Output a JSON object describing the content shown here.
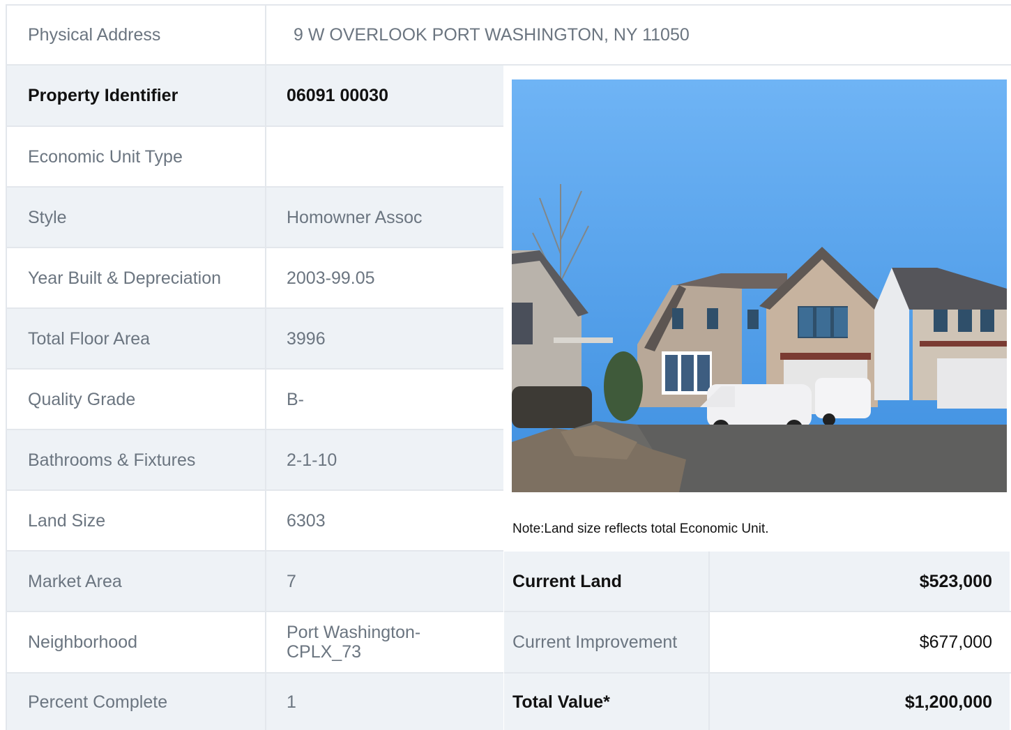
{
  "address": {
    "label": "Physical Address",
    "value": "9 W OVERLOOK   PORT WASHINGTON, NY  11050"
  },
  "details": [
    {
      "label": "Property Identifier",
      "value": "06091  00030"
    },
    {
      "label": "Economic Unit Type",
      "value": ""
    },
    {
      "label": "Style",
      "value": "Homowner Assoc"
    },
    {
      "label": "Year Built & Depreciation",
      "value": "2003-99.05"
    },
    {
      "label": "Total Floor Area",
      "value": "3996"
    },
    {
      "label": "Quality Grade",
      "value": "B-"
    },
    {
      "label": "Bathrooms & Fixtures",
      "value": "2-1-10"
    },
    {
      "label": "Land Size",
      "value": "6303"
    },
    {
      "label": "Market Area",
      "value": "7"
    },
    {
      "label": "Neighborhood",
      "value": "Port Washington-CPLX_73"
    },
    {
      "label": "Percent Complete",
      "value": "1"
    }
  ],
  "note": "Note:Land size reflects total Economic Unit.",
  "valuation": [
    {
      "label": "Current Land",
      "value": "$523,000"
    },
    {
      "label": "Current Improvement",
      "value": "$677,000"
    },
    {
      "label": "Total Value*",
      "value": "$1,200,000"
    }
  ],
  "colors": {
    "shaded_row": "#eef2f6",
    "border": "#e3e7ec",
    "muted_text": "#6b7580",
    "bold_text": "#111111",
    "sky": "#5aa8ee"
  }
}
